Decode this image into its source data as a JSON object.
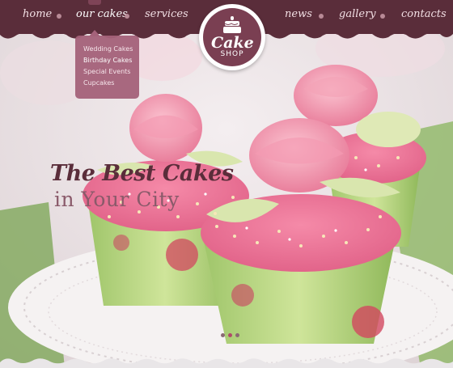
{
  "nav": {
    "home": "home",
    "our_cakes": "our cakes",
    "services": "services",
    "news": "news",
    "gallery": "gallery",
    "contacts": "contacts"
  },
  "logo": {
    "line1": "Cake",
    "line2": "SHOP"
  },
  "dropdown": {
    "items": [
      {
        "label": "Wedding Cakes"
      },
      {
        "label": "Birthday Cakes"
      },
      {
        "label": "Special Events"
      },
      {
        "label": "Cupcakes"
      }
    ]
  },
  "hero": {
    "headline": "The Best Cakes",
    "subheadline": "in Your City"
  },
  "slider": {
    "dots": 3,
    "active_index": 1
  },
  "colors": {
    "bar": "#5a2d3a",
    "accent": "#a5627a",
    "logo_bg": "#7a3f52"
  }
}
